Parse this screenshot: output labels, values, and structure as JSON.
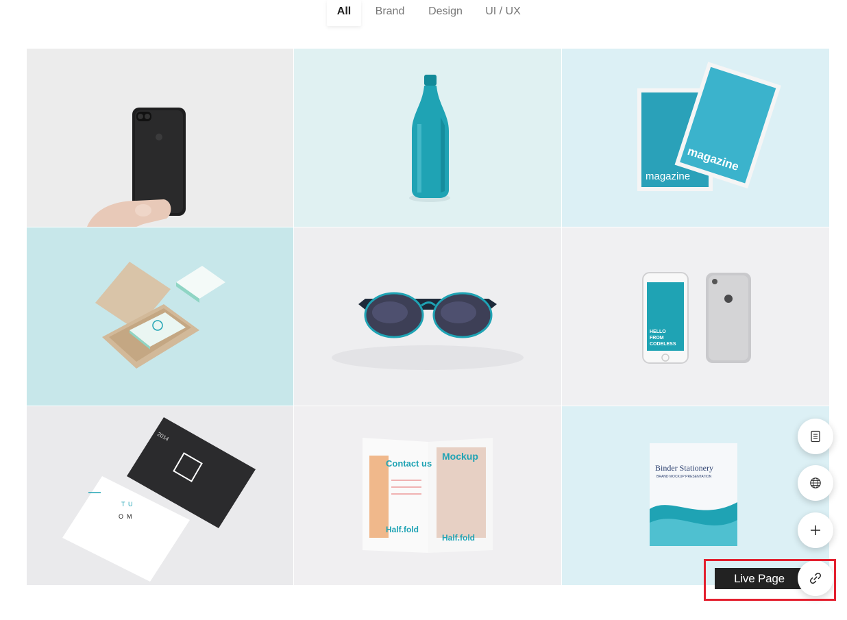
{
  "filters": {
    "tabs": [
      {
        "label": "All",
        "active": true
      },
      {
        "label": "Brand",
        "active": false
      },
      {
        "label": "Design",
        "active": false
      },
      {
        "label": "UI / UX",
        "active": false
      }
    ]
  },
  "portfolio": {
    "items": [
      {
        "subject": "black smartphone held in hand",
        "tile_color": "#ececec"
      },
      {
        "subject": "teal water bottle",
        "tile_color": "#e0f1f2",
        "accent": "#1fa3b4"
      },
      {
        "subject": "magazine mockup",
        "tile_color": "#dcf0f5",
        "text_a": "magazine",
        "text_b": "magazine"
      },
      {
        "subject": "business card box",
        "tile_color": "#c7e7ea"
      },
      {
        "subject": "sunglasses",
        "tile_color": "#eeeef0"
      },
      {
        "subject": "two smartphones",
        "tile_color": "#f0f0f2",
        "screen_text": [
          "HELLO",
          "FROM",
          "CODELESS"
        ]
      },
      {
        "subject": "business cards",
        "tile_color": "#eaeaec",
        "card_text": "2014",
        "logo_text": [
          "T",
          "U",
          "O",
          "M"
        ]
      },
      {
        "subject": "half fold brochure",
        "tile_color": "#f0eff1",
        "left_title": "Contact us",
        "right_title": "Mockup",
        "footer_left": "Half.fold",
        "footer_right": "Half.fold"
      },
      {
        "subject": "binder stationery",
        "tile_color": "#dcf0f5",
        "title": "Binder Stationery",
        "subtitle": "BRAND MOCKUP PRESENTATION"
      }
    ]
  },
  "toolbar": {
    "live_page_label": "Live Page"
  },
  "colors": {
    "teal": "#1fa3b4",
    "dark": "#222222",
    "highlight": "#e3202f"
  }
}
